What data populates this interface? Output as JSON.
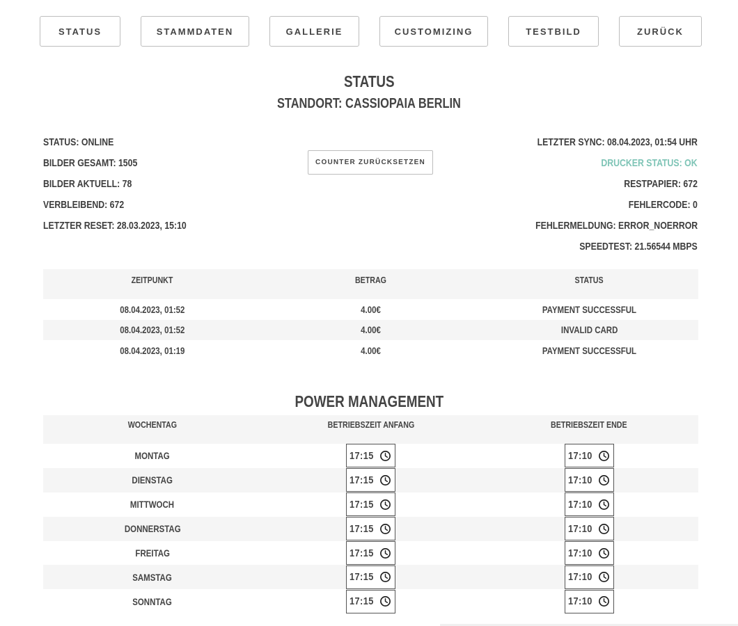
{
  "nav": {
    "items": [
      {
        "label": "STATUS"
      },
      {
        "label": "STAMMDATEN"
      },
      {
        "label": "GALLERIE"
      },
      {
        "label": "CUSTOMIZING"
      },
      {
        "label": "TESTBILD"
      },
      {
        "label": "ZURÜCK"
      }
    ]
  },
  "header": {
    "title": "STATUS",
    "location": "STANDORT: CASSIOPAIA BERLIN"
  },
  "info_left": {
    "status": "STATUS: ONLINE",
    "bilder_gesamt": "BILDER GESAMT: 1505",
    "bilder_aktuell": "BILDER AKTUELL: 78",
    "verbleibend": "VERBLEIBEND: 672",
    "letzter_reset": "LETZTER RESET: 28.03.2023, 15:10"
  },
  "reset_button": {
    "label": "COUNTER ZURÜCKSETZEN"
  },
  "info_right": {
    "letzter_sync": "LETZTER SYNC: 08.04.2023, 01:54 UHR",
    "drucker_status": "DRUCKER STATUS: OK",
    "restpapier": "RESTPAPIER: 672",
    "fehlercode": "FEHLERCODE: 0",
    "fehlermeldung": "FEHLERMELDUNG: ERROR_NOERROR",
    "speedtest": "SPEEDTEST: 21.56544 MBPS"
  },
  "colors": {
    "ok_status": "#7ec4b6",
    "row_stripe": "#f5f5f5",
    "text": "#444444"
  },
  "payments": {
    "headers": [
      "ZEITPUNKT",
      "BETRAG",
      "STATUS"
    ],
    "rows": [
      {
        "zeitpunkt": "08.04.2023, 01:52",
        "betrag": "4.00€",
        "status": "PAYMENT SUCCESSFUL"
      },
      {
        "zeitpunkt": "08.04.2023, 01:52",
        "betrag": "4.00€",
        "status": "INVALID CARD"
      },
      {
        "zeitpunkt": "08.04.2023, 01:19",
        "betrag": "4.00€",
        "status": "PAYMENT SUCCESSFUL"
      }
    ]
  },
  "power": {
    "title": "POWER MANAGEMENT",
    "headers": [
      "WOCHENTAG",
      "BETRIEBSZEIT ANFANG",
      "BETRIEBSZEIT ENDE"
    ],
    "clock_icon": "clock-icon",
    "rows": [
      {
        "day": "MONTAG",
        "start": "17:15",
        "end": "17:10"
      },
      {
        "day": "DIENSTAG",
        "start": "17:15",
        "end": "17:10"
      },
      {
        "day": "MITTWOCH",
        "start": "17:15",
        "end": "17:10"
      },
      {
        "day": "DONNERSTAG",
        "start": "17:15",
        "end": "17:10"
      },
      {
        "day": "FREITAG",
        "start": "17:15",
        "end": "17:10"
      },
      {
        "day": "SAMSTAG",
        "start": "17:15",
        "end": "17:10"
      },
      {
        "day": "SONNTAG",
        "start": "17:15",
        "end": "17:10"
      }
    ]
  }
}
